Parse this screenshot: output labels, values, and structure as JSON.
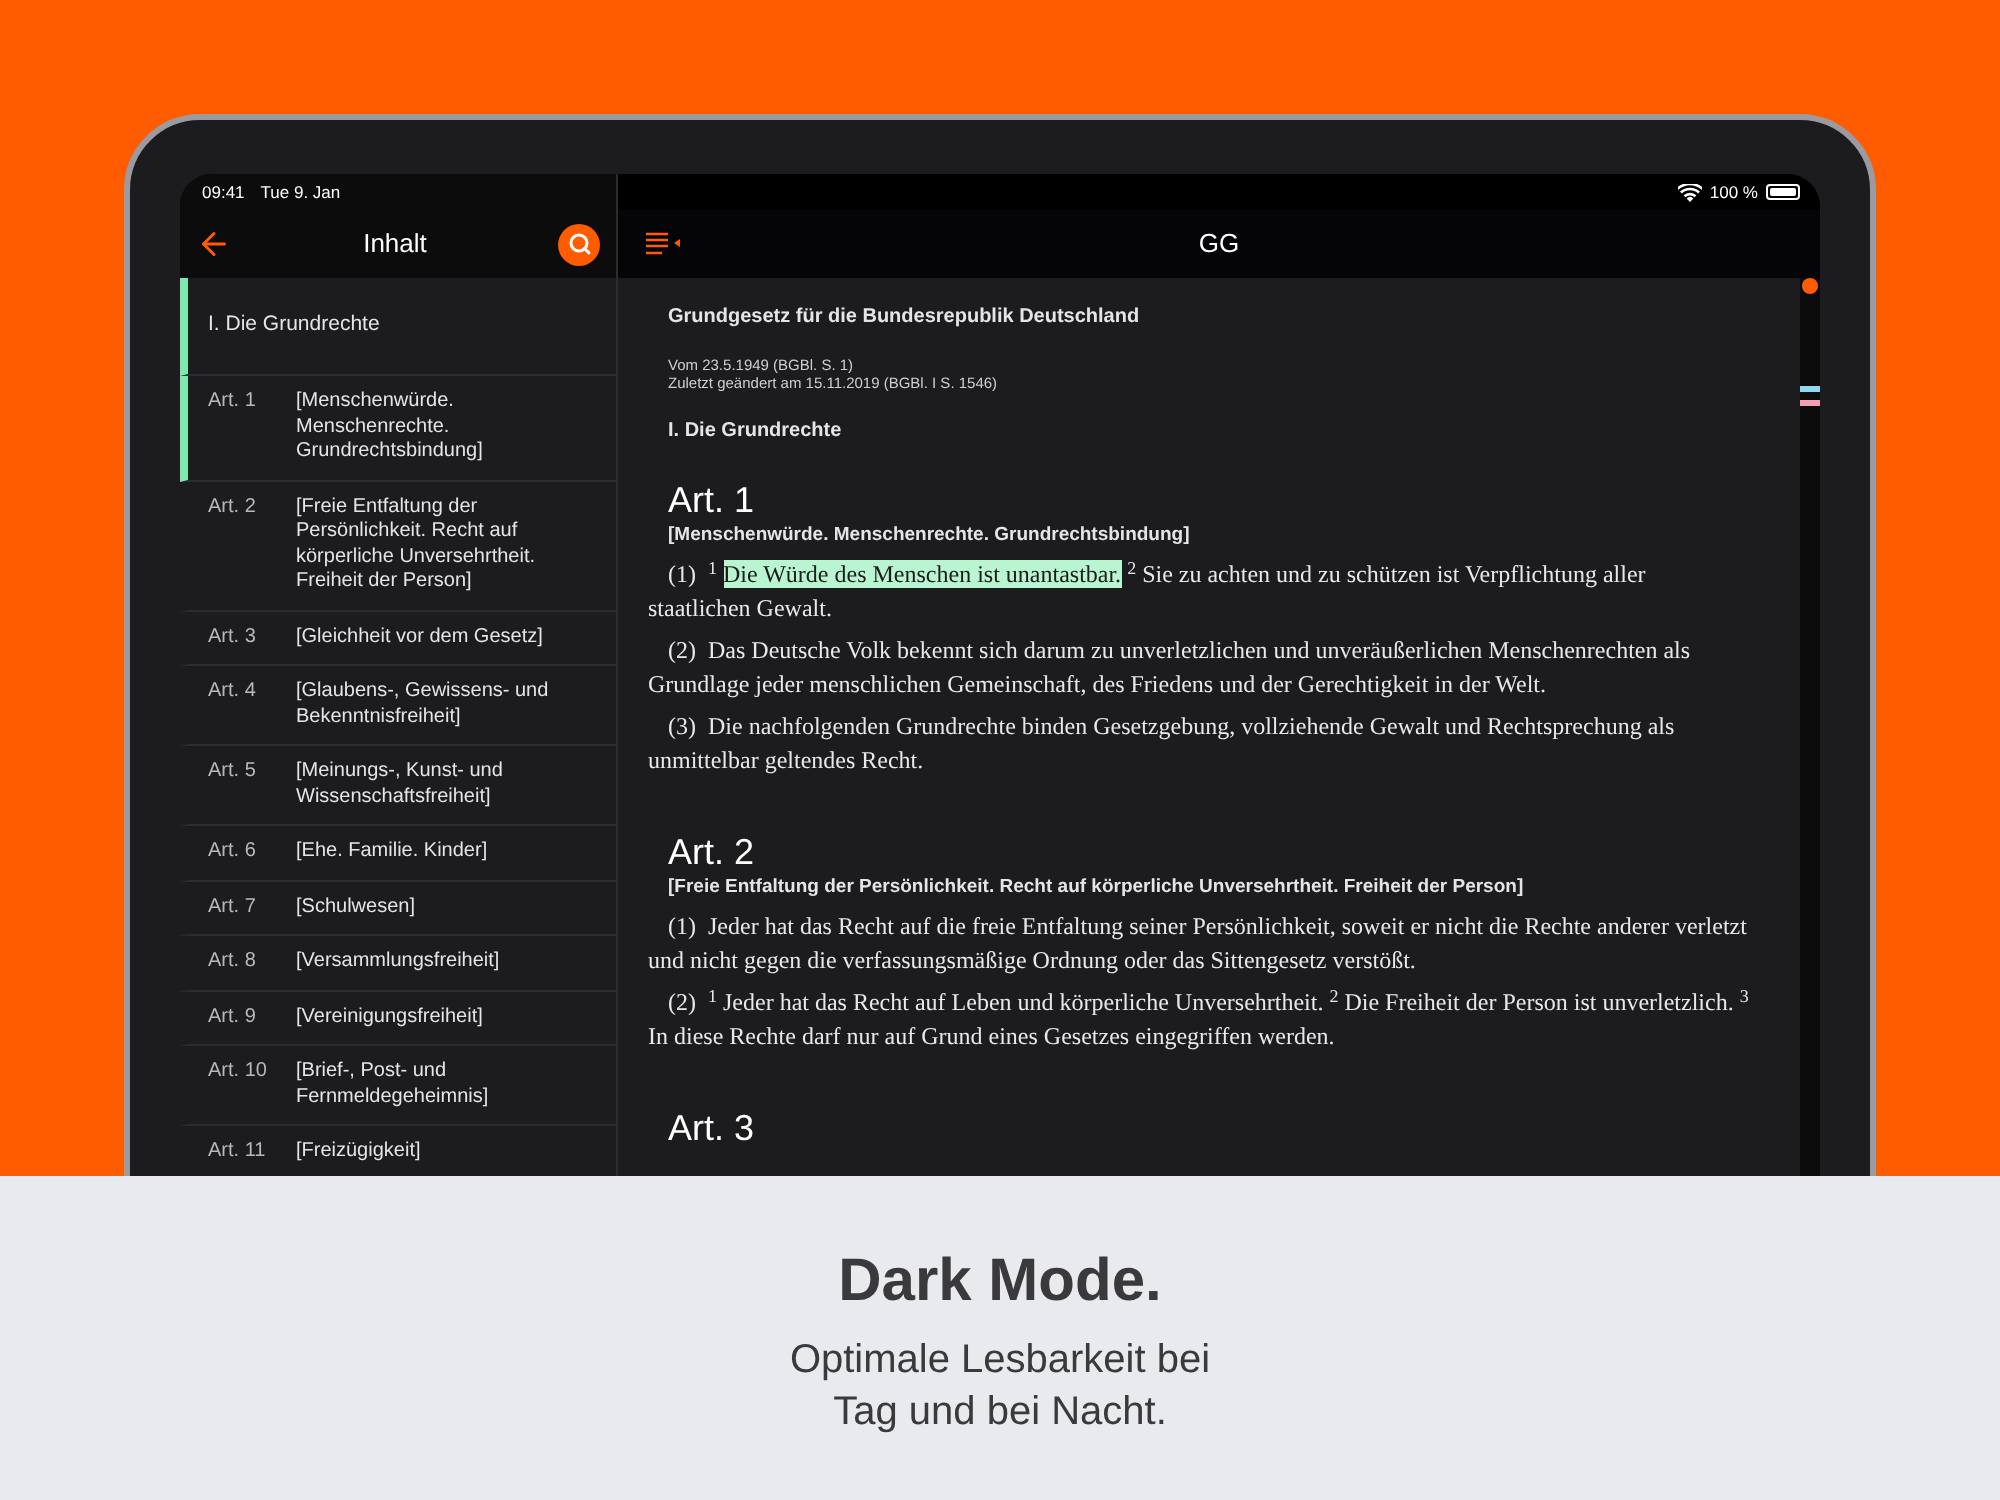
{
  "status_bar": {
    "time": "09:41",
    "date": "Tue 9. Jan",
    "battery": "100 %"
  },
  "sidebar": {
    "title": "Inhalt",
    "section": {
      "label": "I. Die Grundrechte",
      "selected": true
    },
    "items": [
      {
        "number": "Art. 1",
        "title": "[Menschenwürde. Menschenrechte. Grundrechtsbindung]",
        "selected": true
      },
      {
        "number": "Art. 2",
        "title": "[Freie Entfaltung der Persönlichkeit. Recht auf körperliche Unversehrtheit. Freiheit der Person]",
        "selected": false
      },
      {
        "number": "Art. 3",
        "title": "[Gleichheit vor dem Gesetz]",
        "selected": false
      },
      {
        "number": "Art. 4",
        "title": "[Glaubens-, Gewissens- und Bekenntnisfreiheit]",
        "selected": false
      },
      {
        "number": "Art. 5",
        "title": "[Meinungs-, Kunst- und Wissenschaftsfreiheit]",
        "selected": false
      },
      {
        "number": "Art. 6",
        "title": "[Ehe. Familie. Kinder]",
        "selected": false
      },
      {
        "number": "Art. 7",
        "title": "[Schulwesen]",
        "selected": false
      },
      {
        "number": "Art. 8",
        "title": "[Versammlungsfreiheit]",
        "selected": false
      },
      {
        "number": "Art. 9",
        "title": "[Vereinigungsfreiheit]",
        "selected": false
      },
      {
        "number": "Art. 10",
        "title": "[Brief-, Post- und Fernmeldegeheimnis]",
        "selected": false
      },
      {
        "number": "Art. 11",
        "title": "[Freizügigkeit]",
        "selected": false
      }
    ]
  },
  "document": {
    "title": "GG",
    "law_title": "Grundgesetz für die Bundesrepublik Deutschland",
    "meta": [
      "Vom 23.5.1949 (BGBl. S. 1)",
      "Zuletzt geändert am 15.11.2019 (BGBl. I S. 1546)"
    ],
    "section": "I. Die Grundrechte",
    "articles": [
      {
        "heading": "Art. 1",
        "subtitle": "[Menschenwürde. Menschenrechte. Grundrechtsbindung]",
        "paragraphs": [
          {
            "number": "(1)",
            "segments": [
              {
                "text": "$^{1}$ ",
                "highlighted": false
              },
              {
                "text": "Die Würde des Menschen ist unantastbar.",
                "highlighted": true
              },
              {
                "text": " $^{2}$ Sie zu achten und zu schützen ist Verpflichtung aller staatlichen Gewalt.",
                "highlighted": false
              }
            ]
          },
          {
            "number": "(2)",
            "segments": [
              {
                "text": "Das Deutsche Volk bekennt sich darum zu unverletzlichen und unveräußerlichen Menschenrechten als Grundlage jeder menschlichen Gemeinschaft, des Friedens und der Gerechtigkeit in der Welt.",
                "highlighted": false
              }
            ]
          },
          {
            "number": "(3)",
            "segments": [
              {
                "text": "Die nachfolgenden Grundrechte binden Gesetzgebung, vollziehende Gewalt und Rechtsprechung als unmittelbar geltendes Recht.",
                "highlighted": false
              }
            ]
          }
        ]
      },
      {
        "heading": "Art. 2",
        "subtitle": "[Freie Entfaltung der Persönlichkeit. Recht auf körperliche Unversehrtheit. Freiheit der Person]",
        "paragraphs": [
          {
            "number": "(1)",
            "segments": [
              {
                "text": "Jeder hat das Recht auf die freie Entfaltung seiner Persönlichkeit, soweit er nicht die Rechte anderer verletzt und nicht gegen die verfassungsmäßige Ordnung oder das Sittengesetz verstößt.",
                "highlighted": false
              }
            ]
          },
          {
            "number": "(2)",
            "segments": [
              {
                "text": "$^{1}$ Jeder hat das Recht auf Leben und körperliche Unversehrtheit. $^{2}$ Die Freiheit der Person ist unverletzlich. $^{3}$ In diese Rechte darf nur auf Grund eines Gesetzes eingegriffen werden.",
                "highlighted": false
              }
            ]
          }
        ]
      },
      {
        "heading": "Art. 3"
      }
    ]
  },
  "caption": {
    "title": "Dark Mode.",
    "subtitle": "Optimale Lesbarkeit bei Tag und bei Nacht."
  }
}
